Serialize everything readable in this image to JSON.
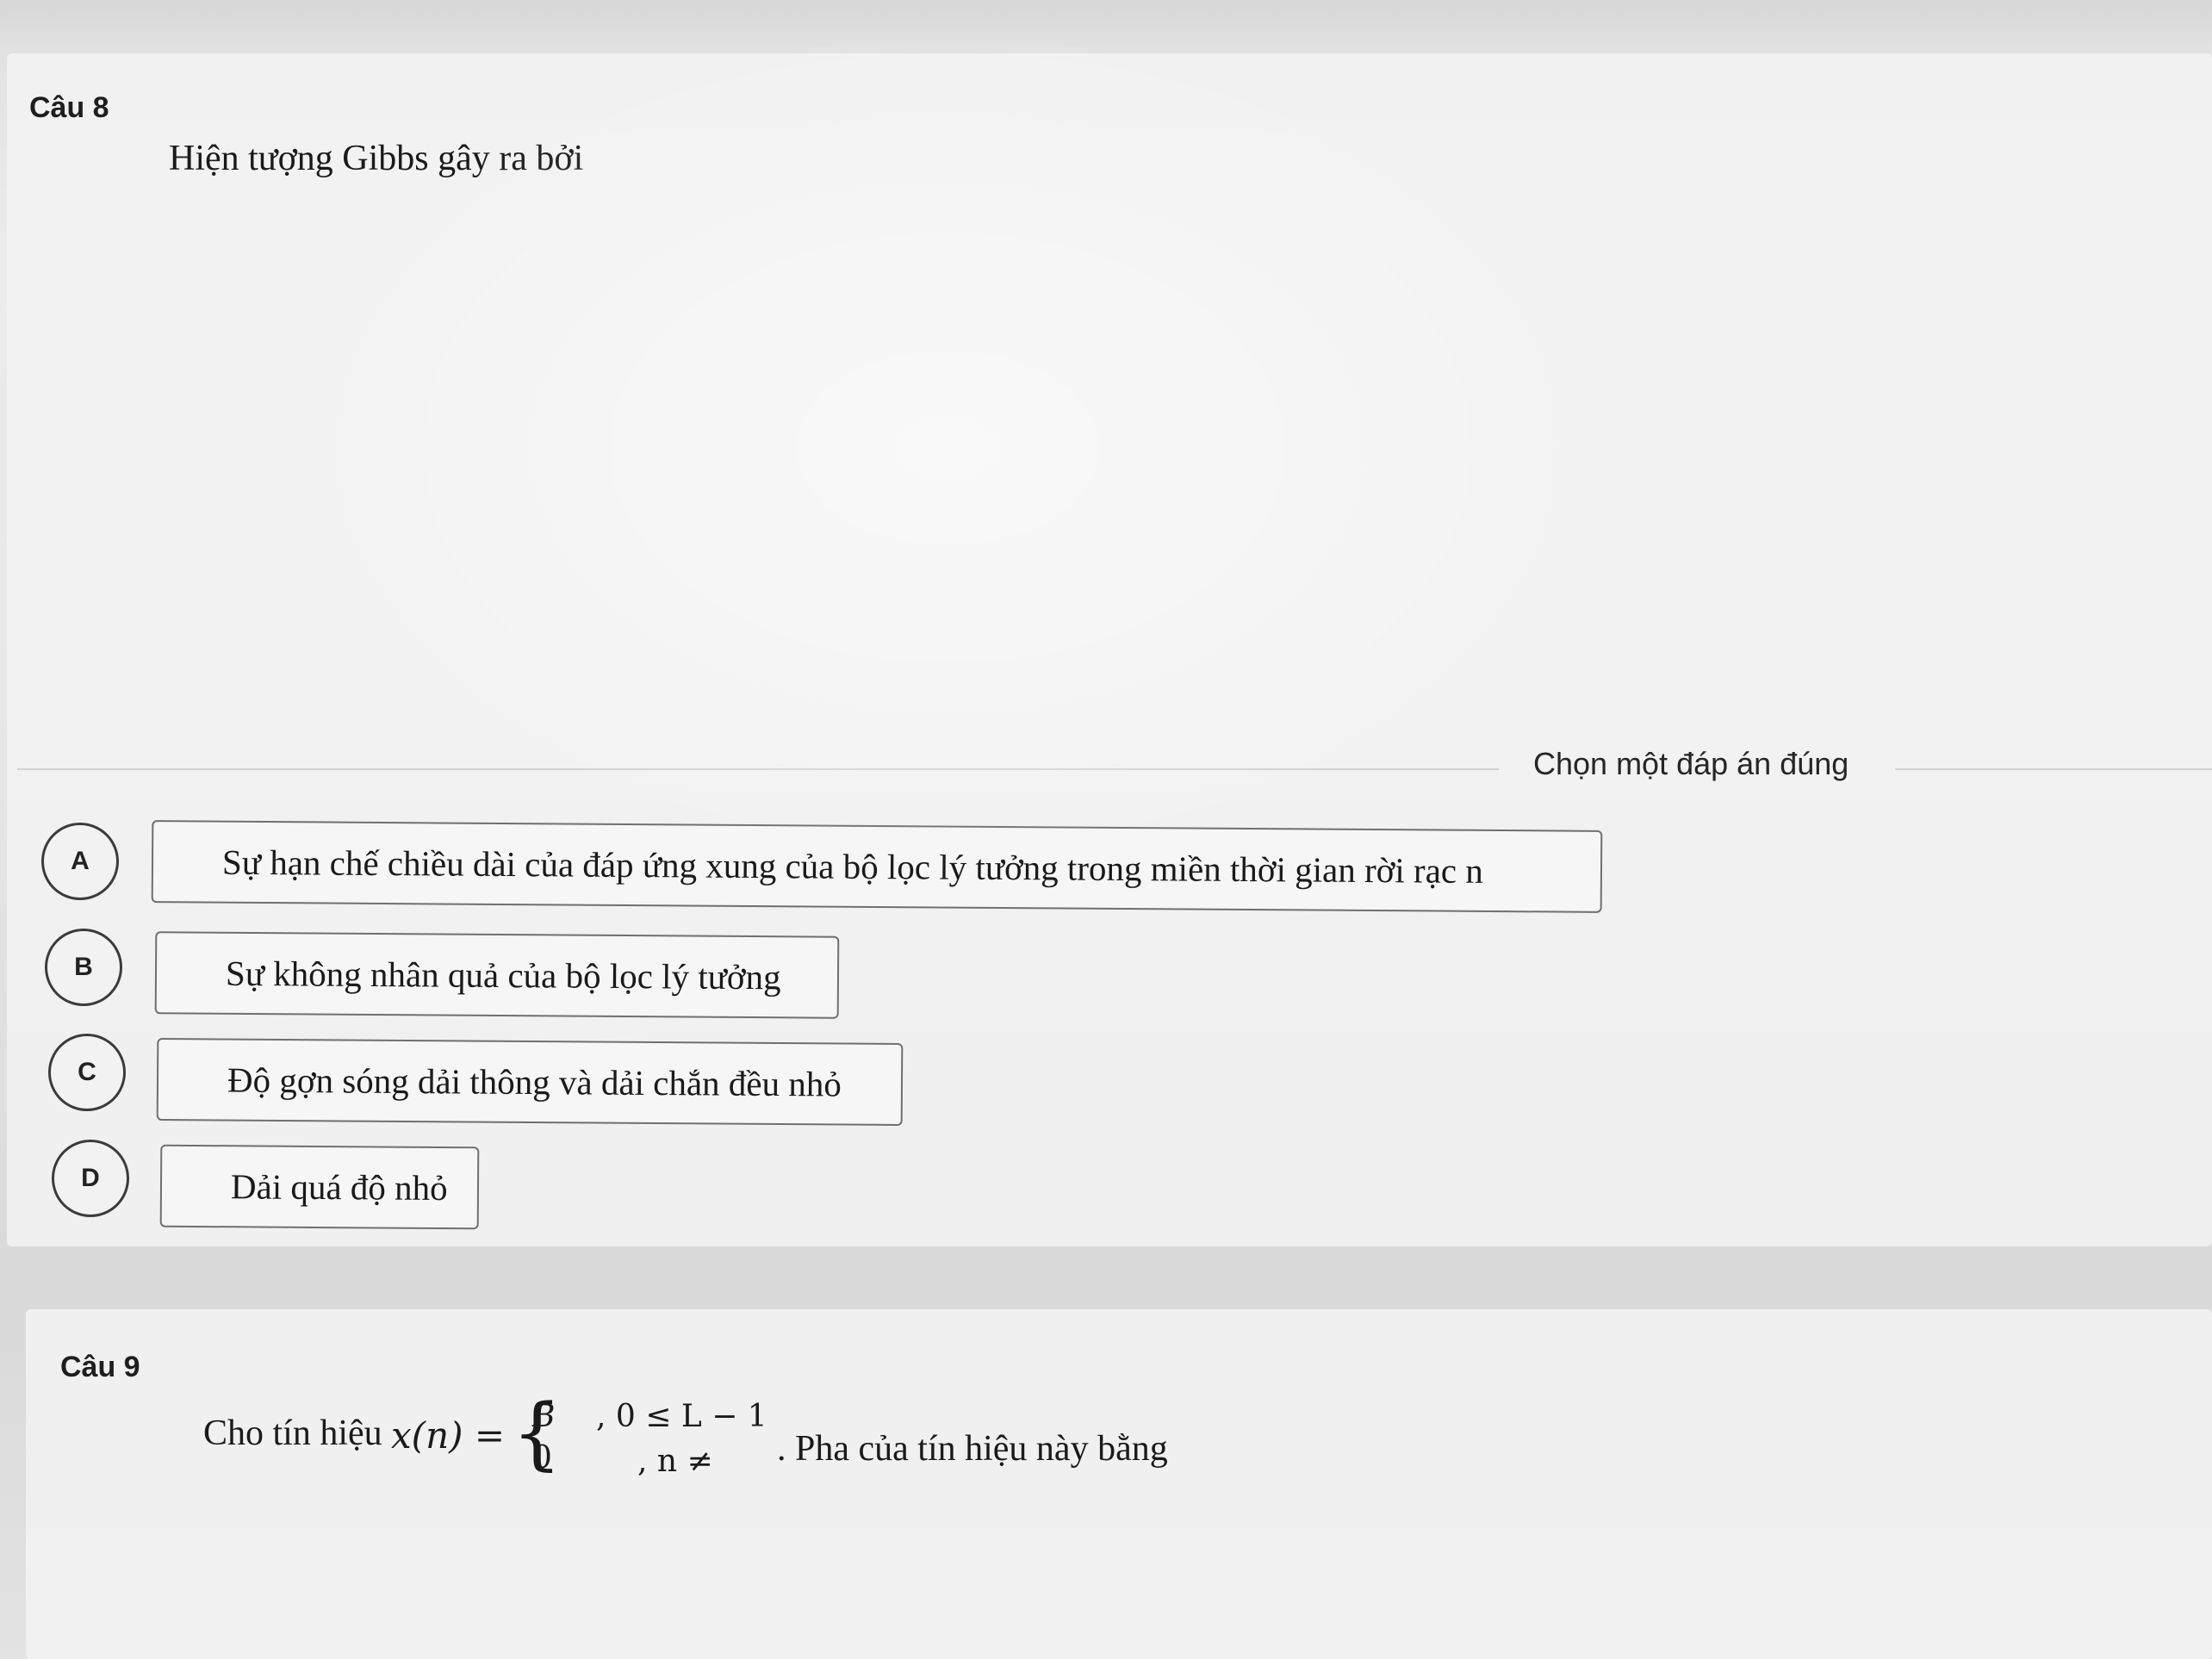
{
  "question8": {
    "number": "Câu 8",
    "text": "Hiện tượng Gibbs gây ra bởi",
    "instruction": "Chọn một đáp án đúng",
    "options": [
      {
        "letter": "A",
        "text": "Sự hạn chế chiều dài của đáp ứng xung của bộ lọc lý tưởng trong miền thời gian rời rạc n"
      },
      {
        "letter": "B",
        "text": "Sự không nhân quả của bộ lọc lý tưởng"
      },
      {
        "letter": "C",
        "text": "Độ gợn sóng dải thông và dải chắn đều nhỏ"
      },
      {
        "letter": "D",
        "text": "Dải quá độ nhỏ"
      }
    ]
  },
  "question9": {
    "number": "Câu 9",
    "text_before": "Cho tín hiệu",
    "signal": "x(n) =",
    "brace": "{",
    "case1_value": "B",
    "case1_condition": ", 0 ≤ L − 1",
    "case2_value": "0",
    "case2_condition": ", n ≠",
    "text_after": ". Pha của tín hiệu này bằng"
  }
}
